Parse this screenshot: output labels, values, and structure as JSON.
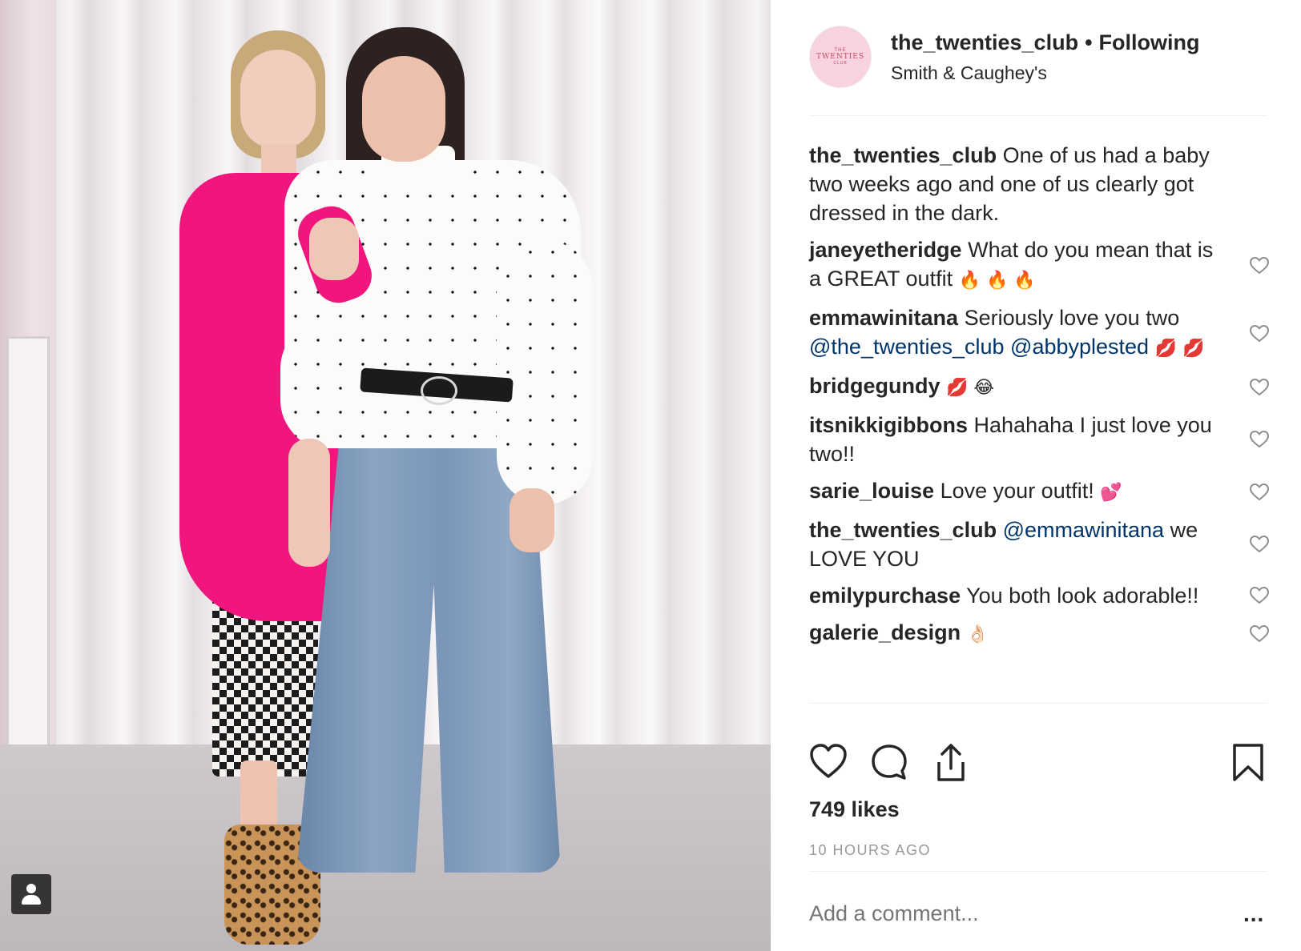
{
  "post": {
    "username": "the_twenties_club",
    "separator": "•",
    "follow_state": "Following",
    "location": "Smith & Caughey's",
    "avatar": {
      "line1": "THE",
      "line2": "TWENTIES",
      "line3": "CLUB",
      "bg": "#f8d3df",
      "fg": "#c94463"
    }
  },
  "comments": [
    {
      "user": "the_twenties_club",
      "text": "One of us had a baby two weeks ago and one of us clearly got dressed in the dark.",
      "heart": false
    },
    {
      "user": "janeyetheridge",
      "text": "What do you mean that is a GREAT outfit",
      "emoji": "🔥 🔥 🔥",
      "heart": true
    },
    {
      "user": "emmawinitana",
      "text": "Seriously love you two",
      "mentions": "@the_twenties_club @abbyplested",
      "emoji": "💋 💋",
      "heart": true
    },
    {
      "user": "bridgegundy",
      "text": "",
      "emoji": "💋 😂",
      "heart": true
    },
    {
      "user": "itsnikkigibbons",
      "text": "Hahahaha I just love you two!!",
      "heart": true
    },
    {
      "user": "sarie_louise",
      "text": "Love your outfit!",
      "emoji": "💕",
      "heart": true
    },
    {
      "user": "the_twenties_club",
      "mention": "@emmawinitana",
      "text": "we LOVE YOU",
      "heart": true
    },
    {
      "user": "emilypurchase",
      "text": "You both look adorable!!",
      "heart": true
    },
    {
      "user": "galerie_design",
      "text": "",
      "emoji": "👌🏻",
      "heart": true
    }
  ],
  "actions": {
    "like_icon": "heart-icon",
    "comment_icon": "comment-bubble-icon",
    "share_icon": "share-upload-icon",
    "save_icon": "bookmark-icon"
  },
  "likes": "749 likes",
  "time_ago": "10 HOURS AGO",
  "add_comment": {
    "placeholder": "Add a comment..."
  },
  "more_options": "...",
  "colors": {
    "text": "#262626",
    "muted": "#999999",
    "mention": "#003569",
    "divider": "#efefef"
  }
}
